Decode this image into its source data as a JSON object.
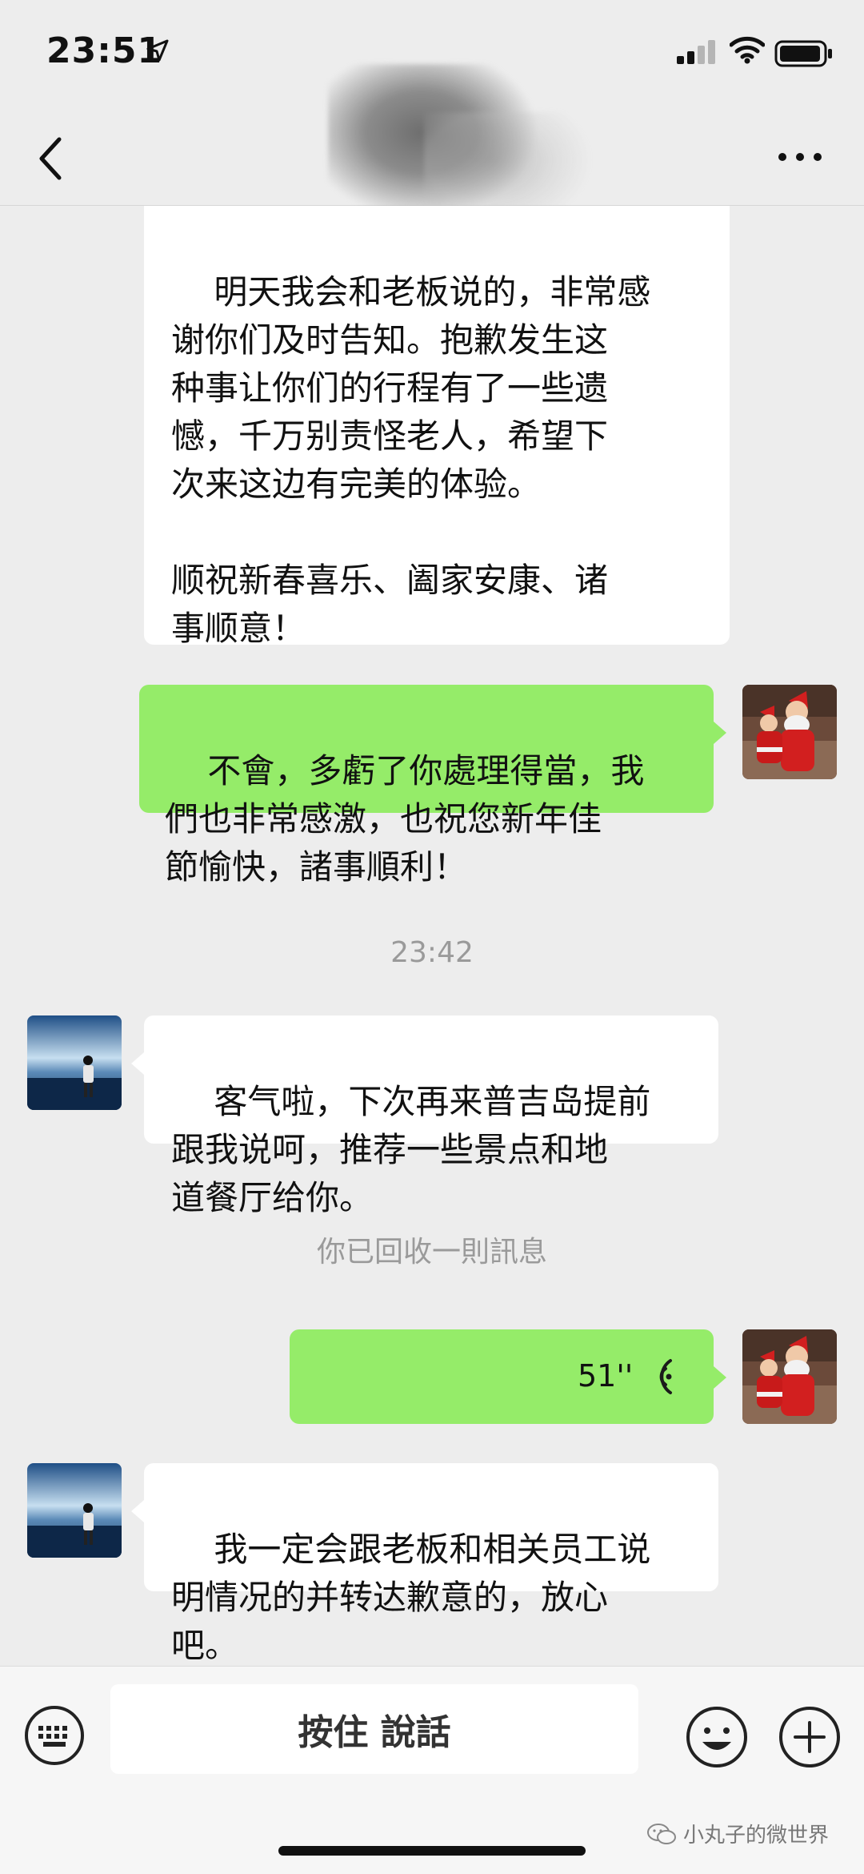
{
  "status_bar": {
    "time": "23:51"
  },
  "nav": {
    "title": ""
  },
  "messages": [
    {
      "side": "in",
      "text": "明天我会和老板说的，非常感\n谢你们及时告知。抱歉发生这\n种事让你们的行程有了一些遗\n憾，千万别责怪老人，希望下\n次来这边有完美的体验。\n\n顺祝新春喜乐、阖家安康、诸\n事顺意！"
    },
    {
      "side": "out",
      "text": "不會，多虧了你處理得當，我\n們也非常感激，也祝您新年佳\n節愉快，諸事順利！"
    },
    {
      "type": "timestamp",
      "text": "23:42"
    },
    {
      "side": "in",
      "text": "客气啦，下次再来普吉岛提前\n跟我说呵，推荐一些景点和地\n道餐厅给你。"
    },
    {
      "type": "system",
      "text": "你已回收一則訊息"
    },
    {
      "side": "out",
      "type": "voice",
      "duration": "51''"
    },
    {
      "side": "in",
      "text": "我一定会跟老板和相关员工说\n明情况的并转达歉意的，放心\n吧。"
    }
  ],
  "input_bar": {
    "hold_to_talk_label": "按住 說話"
  },
  "watermark": {
    "text": "小丸子的微世界"
  },
  "colors": {
    "background": "#ededed",
    "outgoing_bubble": "#95ec69",
    "incoming_bubble": "#ffffff"
  }
}
